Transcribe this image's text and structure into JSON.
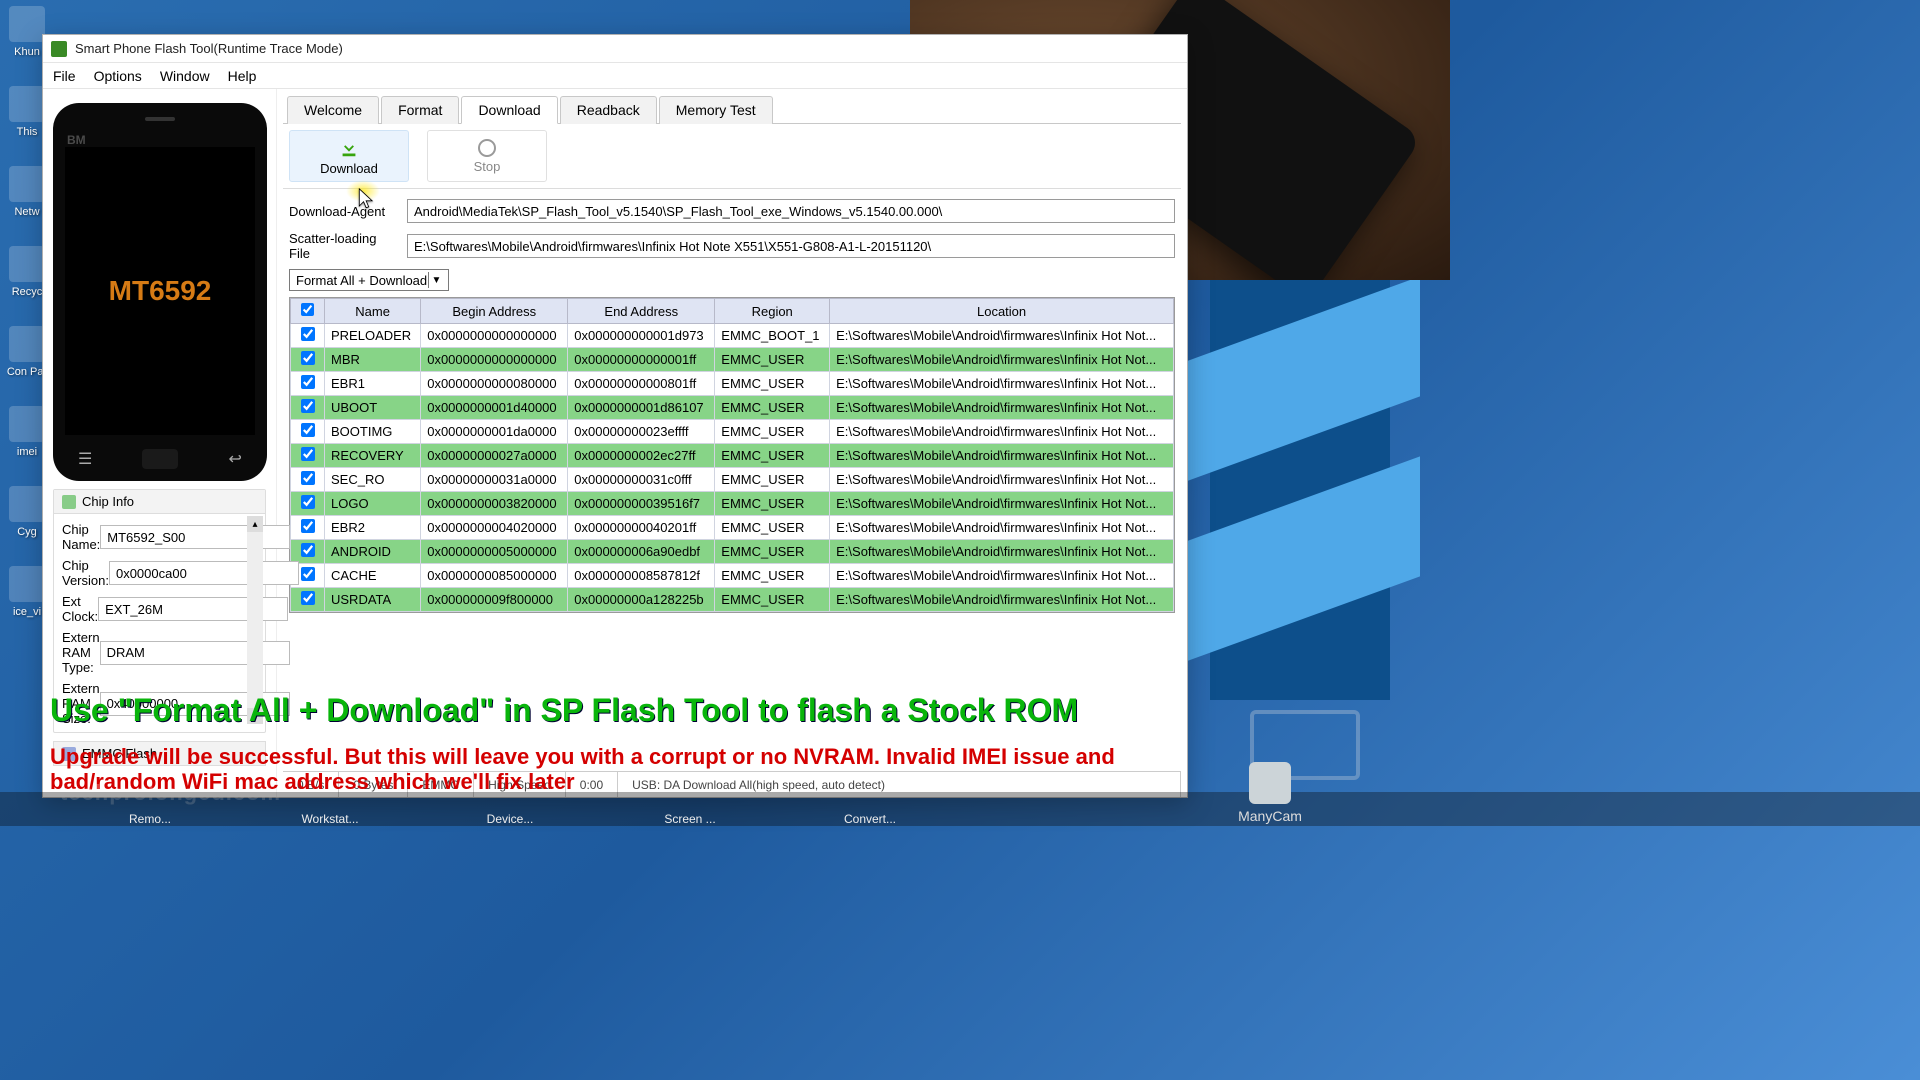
{
  "window": {
    "title": "Smart Phone Flash Tool(Runtime Trace Mode)"
  },
  "menubar": [
    "File",
    "Options",
    "Window",
    "Help"
  ],
  "tabs": [
    "Welcome",
    "Format",
    "Download",
    "Readback",
    "Memory Test"
  ],
  "active_tab": "Download",
  "toolbar": {
    "download": "Download",
    "stop": "Stop"
  },
  "paths": {
    "da_label": "Download-Agent",
    "da_value": "Android\\MediaTek\\SP_Flash_Tool_v5.1540\\SP_Flash_Tool_exe_Windows_v5.1540.00.000\\",
    "scatter_label": "Scatter-loading File",
    "scatter_value": "E:\\Softwares\\Mobile\\Android\\firmwares\\Infinix Hot Note X551\\X551-G808-A1-L-20151120\\"
  },
  "combo": {
    "selected": "Format All + Download"
  },
  "grid": {
    "headers": [
      "",
      "Name",
      "Begin Address",
      "End Address",
      "Region",
      "Location"
    ],
    "loc": "E:\\Softwares\\Mobile\\Android\\firmwares\\Infinix Hot Not...",
    "rows": [
      {
        "hl": false,
        "name": "PRELOADER",
        "begin": "0x0000000000000000",
        "end": "0x000000000001d973",
        "region": "EMMC_BOOT_1"
      },
      {
        "hl": true,
        "name": "MBR",
        "begin": "0x0000000000000000",
        "end": "0x00000000000001ff",
        "region": "EMMC_USER"
      },
      {
        "hl": false,
        "name": "EBR1",
        "begin": "0x0000000000080000",
        "end": "0x00000000000801ff",
        "region": "EMMC_USER"
      },
      {
        "hl": true,
        "name": "UBOOT",
        "begin": "0x0000000001d40000",
        "end": "0x0000000001d86107",
        "region": "EMMC_USER"
      },
      {
        "hl": false,
        "name": "BOOTIMG",
        "begin": "0x0000000001da0000",
        "end": "0x00000000023effff",
        "region": "EMMC_USER"
      },
      {
        "hl": true,
        "name": "RECOVERY",
        "begin": "0x00000000027a0000",
        "end": "0x0000000002ec27ff",
        "region": "EMMC_USER"
      },
      {
        "hl": false,
        "name": "SEC_RO",
        "begin": "0x00000000031a0000",
        "end": "0x00000000031c0fff",
        "region": "EMMC_USER"
      },
      {
        "hl": true,
        "name": "LOGO",
        "begin": "0x0000000003820000",
        "end": "0x00000000039516f7",
        "region": "EMMC_USER"
      },
      {
        "hl": false,
        "name": "EBR2",
        "begin": "0x0000000004020000",
        "end": "0x00000000040201ff",
        "region": "EMMC_USER"
      },
      {
        "hl": true,
        "name": "ANDROID",
        "begin": "0x0000000005000000",
        "end": "0x000000006a90edbf",
        "region": "EMMC_USER"
      },
      {
        "hl": false,
        "name": "CACHE",
        "begin": "0x0000000085000000",
        "end": "0x000000008587812f",
        "region": "EMMC_USER"
      },
      {
        "hl": true,
        "name": "USRDATA",
        "begin": "0x000000009f800000",
        "end": "0x00000000a128225b",
        "region": "EMMC_USER"
      }
    ]
  },
  "phone_preview": {
    "brand": "BM",
    "chip_text": "MT6592"
  },
  "chip_info": {
    "title": "Chip Info",
    "fields": {
      "chip_name_label": "Chip Name:",
      "chip_name_value": "MT6592_S00",
      "chip_ver_label": "Chip Version:",
      "chip_ver_value": "0x0000ca00",
      "ext_clock_label": "Ext Clock:",
      "ext_clock_value": "EXT_26M",
      "ram_type_label": "Extern RAM Type:",
      "ram_type_value": "DRAM",
      "ram_size_label": "Extern RAM Size:",
      "ram_size_value": "0x40000000"
    }
  },
  "emmc": {
    "title": "EMMC Flash"
  },
  "statusbar": {
    "speed": "0 B/s",
    "bytes": "0 Bytes",
    "storage": "EMMC",
    "mode": "High Speed",
    "time": "0:00",
    "usb": "USB: DA Download All(high speed, auto detect)"
  },
  "desktop_icons": [
    "Khun",
    "This",
    "Netw",
    "Recyc",
    "Con Par",
    "imei",
    "Cyg",
    "ice_vi"
  ],
  "overlay": {
    "green": "Use \"Format All + Download\" in SP Flash Tool to flash a Stock ROM",
    "red": "Upgrade will be successful. But this will leave you with a corrupt or no NVRAM. Invalid IMEI issue and bad/random WiFi mac address which we'll fix later",
    "watermark": "techprolonged.com"
  },
  "taskbar_items": [
    "Remo...",
    "Workstat...",
    "Device...",
    "Screen ...",
    "Convert..."
  ],
  "tray": {
    "label": "ManyCam"
  }
}
